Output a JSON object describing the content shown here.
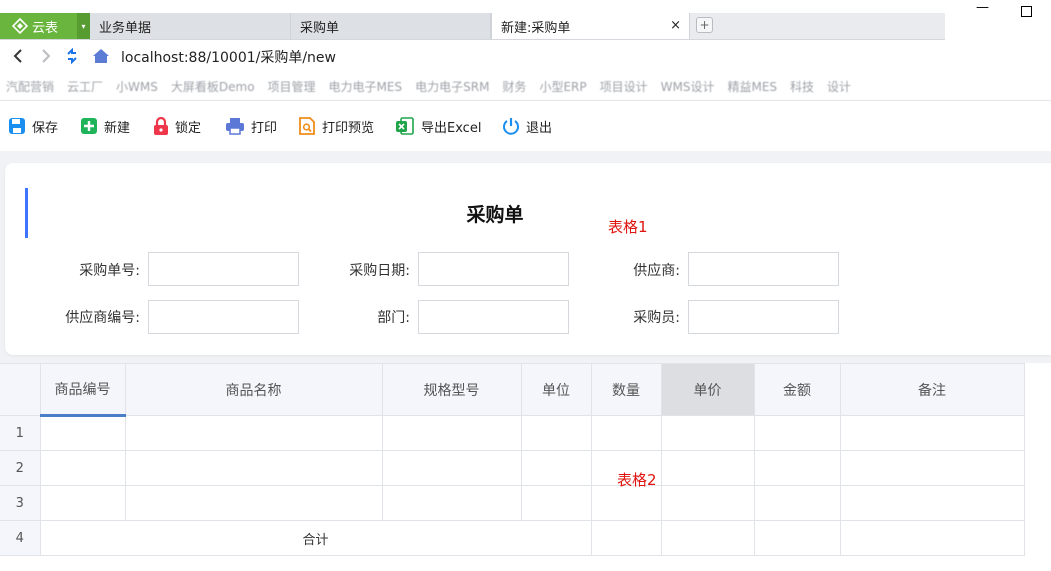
{
  "browser": {
    "app": {
      "name": "云表"
    },
    "tabs": [
      {
        "label": "业务单据"
      },
      {
        "label": "采购单"
      },
      {
        "label": "新建:采购单"
      }
    ],
    "tab_close": "×",
    "new_tab": "+",
    "url": "localhost:88/10001/采购单/new",
    "bookmarks": [
      "汽配营销",
      "云工厂",
      "小WMS",
      "大屏看板Demo",
      "项目管理",
      "电力电子MES",
      "电力电子SRM",
      "财务",
      "小型ERP",
      "项目设计",
      "WMS设计",
      "精益MES",
      "科技",
      "设计"
    ]
  },
  "toolbar": {
    "items": [
      {
        "label": "保存",
        "icon": "save-icon",
        "color": "#1a8ff0"
      },
      {
        "label": "新建",
        "icon": "add-icon",
        "color": "#1fb35a"
      },
      {
        "label": "锁定",
        "icon": "lock-icon",
        "color": "#f0364a"
      },
      {
        "label": "打印",
        "icon": "printer-icon",
        "color": "#5c78d6"
      },
      {
        "label": "打印预览",
        "icon": "print-preview-icon",
        "color": "#f08c1a"
      },
      {
        "label": "导出Excel",
        "icon": "excel-icon",
        "color": "#1fa54a"
      },
      {
        "label": "退出",
        "icon": "power-icon",
        "color": "#1a8ff0"
      }
    ]
  },
  "form": {
    "title": "采购单",
    "annotation": "表格1",
    "fields": {
      "order_no": {
        "label": "采购单号:",
        "value": ""
      },
      "order_date": {
        "label": "采购日期:",
        "value": ""
      },
      "supplier": {
        "label": "供应商:",
        "value": ""
      },
      "supplier_code": {
        "label": "供应商编号:",
        "value": ""
      },
      "department": {
        "label": "部门:",
        "value": ""
      },
      "buyer": {
        "label": "采购员:",
        "value": ""
      }
    }
  },
  "grid": {
    "annotation": "表格2",
    "columns": [
      "商品编号",
      "商品名称",
      "规格型号",
      "单位",
      "数量",
      "单价",
      "金额",
      "备注"
    ],
    "rows": [
      "1",
      "2",
      "3"
    ],
    "total_row": {
      "number": "4",
      "label": "合计"
    }
  },
  "colors": {
    "app_brand": "#69b53d",
    "accent": "#3f74ff",
    "annotation": "#e0140f"
  }
}
